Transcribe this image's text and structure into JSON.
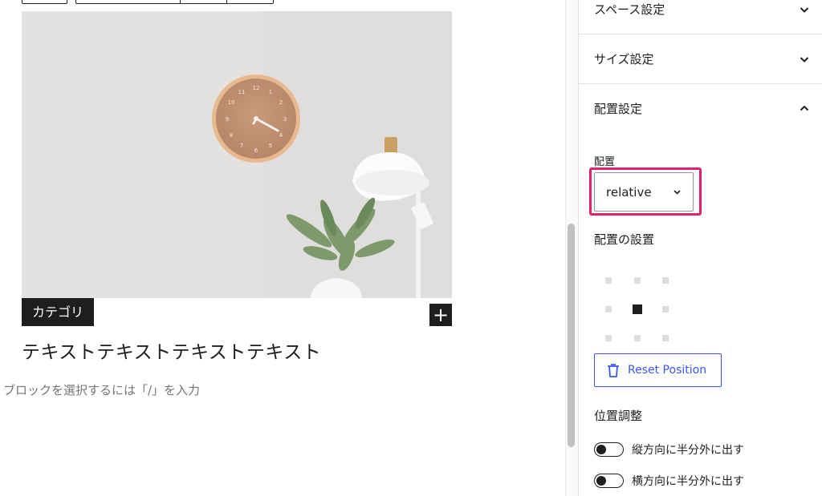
{
  "sidebar": {
    "panels": [
      {
        "label": "スペース設定",
        "state": "collapsed"
      },
      {
        "label": "サイズ設定",
        "state": "collapsed"
      },
      {
        "label": "配置設定",
        "state": "expanded"
      }
    ],
    "position": {
      "label": "配置",
      "value": "relative",
      "placement_title": "配置の設置",
      "selected_cell": "center",
      "reset_label": "Reset Position",
      "adjust_title": "位置調整",
      "toggles": [
        {
          "label": "縦方向に半分外に出す",
          "checked": false
        },
        {
          "label": "横方向に半分外に出す",
          "checked": false
        }
      ]
    },
    "highlight_color": "#e5206f",
    "accent_color": "#3858e9"
  },
  "editor": {
    "category_badge": "カテゴリ",
    "add_button_label": "+",
    "card_title": "テキストテキストテキストテキスト",
    "block_placeholder": "ブロックを選択するには「/」を入力"
  }
}
